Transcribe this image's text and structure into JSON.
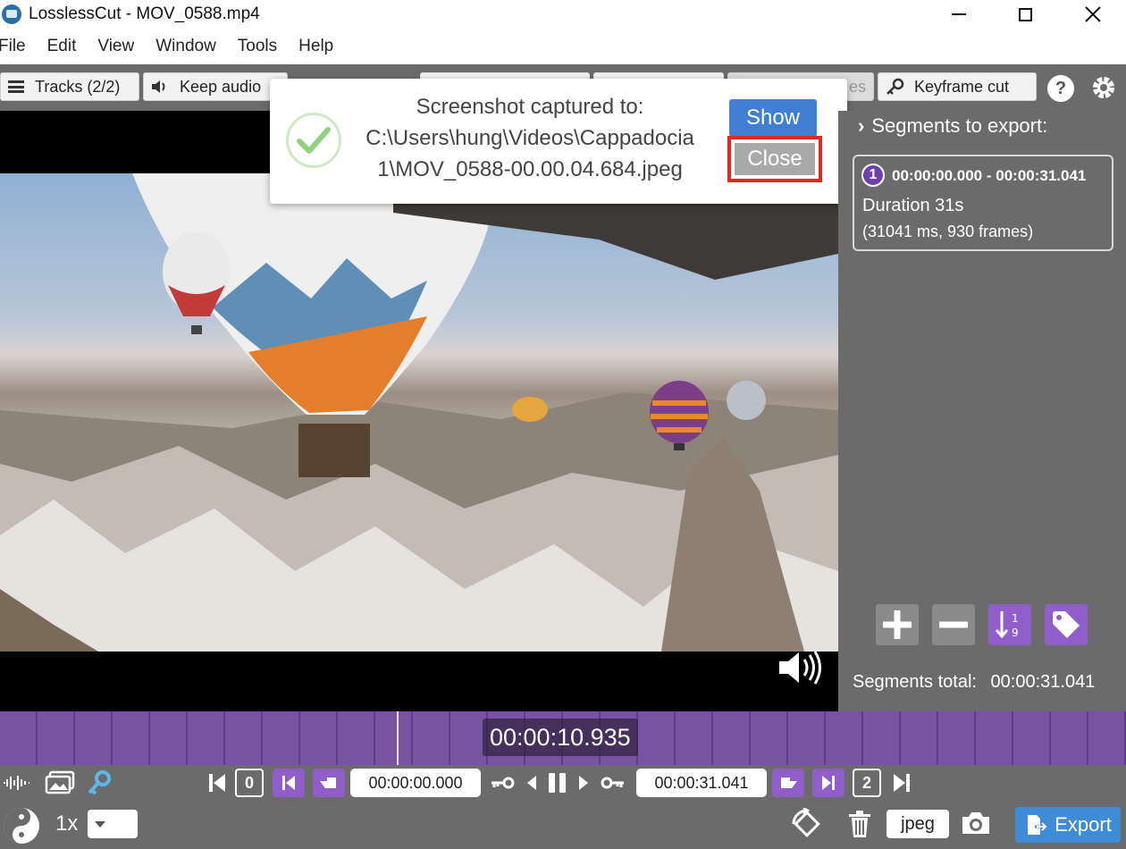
{
  "window": {
    "title": "LosslessCut - MOV_0588.mp4",
    "icons": [
      "app-icon",
      "minimize-icon",
      "maximize-icon",
      "close-icon"
    ]
  },
  "menu": {
    "items": [
      "File",
      "Edit",
      "View",
      "Window",
      "Tools",
      "Help"
    ]
  },
  "toolbar": {
    "tracks_label": "Tracks (2/2)",
    "keep_audio_label": "Keep audio",
    "partial_label": "es",
    "keyframe_label": "Keyframe cut",
    "help_label": "?"
  },
  "toast": {
    "title": "Screenshot captured to:",
    "path_line1": "C:\\Users\\hung\\Videos\\Cappadocia",
    "path_line2": "1\\MOV_0588-00.00.04.684.jpeg",
    "show_label": "Show",
    "close_label": "Close"
  },
  "segments": {
    "header": "Segments to export:",
    "items": [
      {
        "number": "1",
        "range": "00:00:00.000 - 00:00:31.041",
        "duration": "Duration 31s",
        "frames": "(31041 ms, 930 frames)"
      }
    ],
    "total_label": "Segments total:",
    "total_value": "00:00:31.041"
  },
  "timeline": {
    "current_time": "00:00:10.935",
    "playhead_fraction": 0.352
  },
  "controls": {
    "start_badge": "0",
    "start_time": "00:00:00.000",
    "end_time": "00:00:31.041",
    "end_badge": "2",
    "speed": "1x",
    "capture_format": "jpeg",
    "export_label": "Export"
  },
  "colors": {
    "accent_purple": "#8f5ec9",
    "timeline_purple": "#7a52a3",
    "export_blue": "#3f8bd6",
    "show_blue": "#3f7fd4",
    "highlight_red": "#e02b20"
  }
}
